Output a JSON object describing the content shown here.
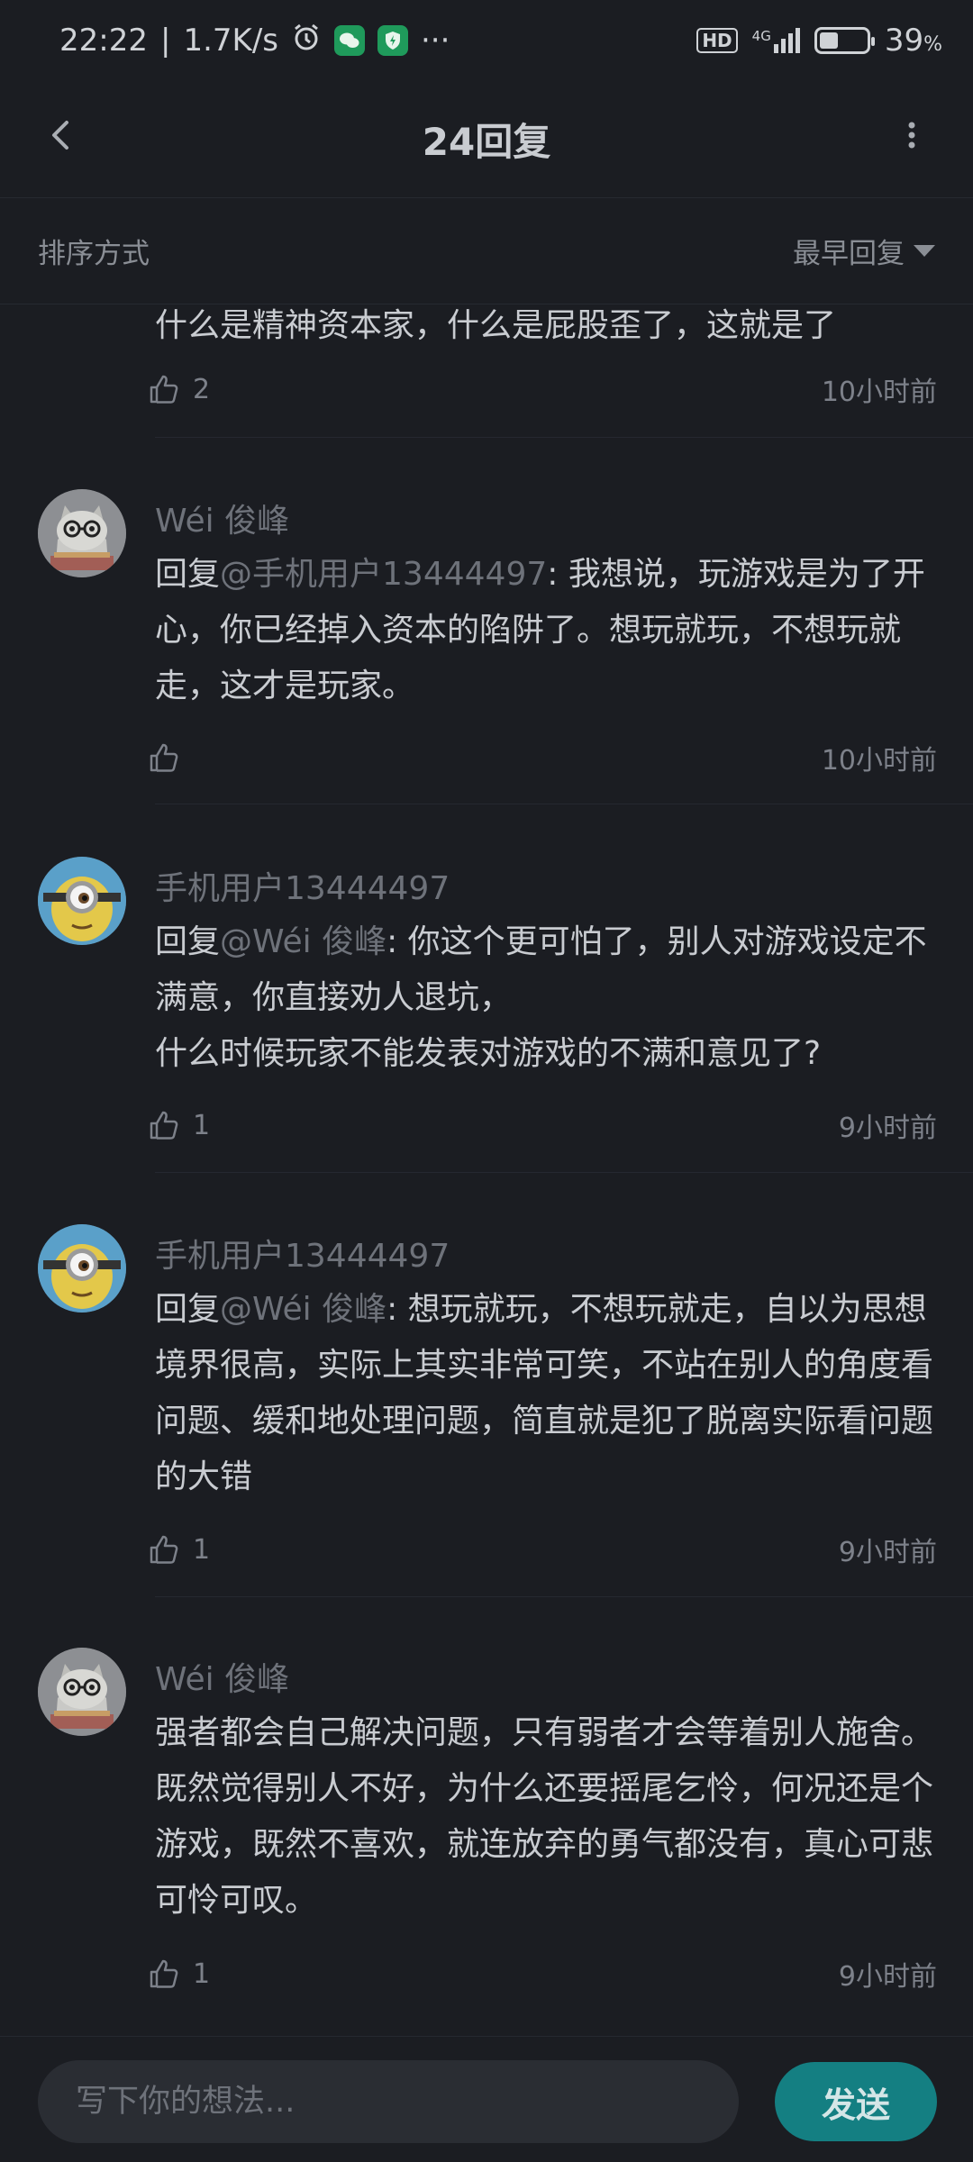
{
  "status_bar": {
    "time": "22:22",
    "speed": "1.7K/s",
    "hd": "HD",
    "network": "4G",
    "battery": "39",
    "battery_unit": "%",
    "battery_level": 0.39
  },
  "header": {
    "title": "24回复"
  },
  "sort": {
    "label": "排序方式",
    "selected": "最早回复"
  },
  "partial_comment": {
    "text": "什么是精神资本家，什么是屁股歪了，这就是了",
    "likes": "2",
    "time": "10小时前"
  },
  "comments": [
    {
      "user": "Wéi 俊峰",
      "avatar": "cat-avatar",
      "prefix": "回复",
      "mention": "@手机用户13444497",
      "text": ": 我想说，玩游戏是为了开心，你已经掉入资本的陷阱了。想玩就玩，不想玩就走，这才是玩家。",
      "likes": "",
      "time": "10小时前"
    },
    {
      "user": "手机用户13444497",
      "avatar": "minion-avatar",
      "prefix": "回复",
      "mention": "@Wéi 俊峰",
      "text": ": 你这个更可怕了，别人对游戏设定不满意，你直接劝人退坑，\n什么时候玩家不能发表对游戏的不满和意见了?",
      "likes": "1",
      "time": "9小时前"
    },
    {
      "user": "手机用户13444497",
      "avatar": "minion-avatar",
      "prefix": "回复",
      "mention": "@Wéi 俊峰",
      "text": ": 想玩就玩，不想玩就走，自以为思想境界很高，实际上其实非常可笑，不站在别人的角度看问题、缓和地处理问题，简直就是犯了脱离实际看问题的大错",
      "likes": "1",
      "time": "9小时前"
    },
    {
      "user": "Wéi 俊峰",
      "avatar": "cat-avatar",
      "prefix": "",
      "mention": "",
      "text": "强者都会自己解决问题，只有弱者才会等着别人施舍。既然觉得别人不好，为什么还要摇尾乞怜，何况还是个游戏，既然不喜欢，就连放弃的勇气都没有，真心可悲可怜可叹。",
      "likes": "1",
      "time": "9小时前"
    }
  ],
  "composer": {
    "placeholder": "写下你的想法...",
    "send_label": "发送"
  },
  "colors": {
    "background": "#1b1d22",
    "accent": "#147f82"
  }
}
